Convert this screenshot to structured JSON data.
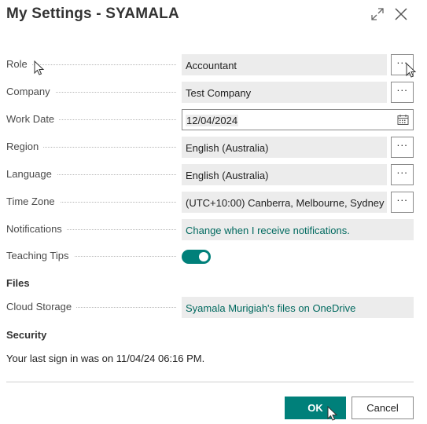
{
  "dialog": {
    "title": "My Settings - SYAMALA"
  },
  "fields": {
    "role": {
      "label": "Role",
      "value": "Accountant",
      "button": "···"
    },
    "company": {
      "label": "Company",
      "value": "Test Company",
      "button": "···"
    },
    "work_date": {
      "label": "Work Date",
      "value": "12/04/2024"
    },
    "region": {
      "label": "Region",
      "value": "English (Australia)",
      "button": "···"
    },
    "language": {
      "label": "Language",
      "value": "English (Australia)",
      "button": "···"
    },
    "time_zone": {
      "label": "Time Zone",
      "value": "(UTC+10:00) Canberra, Melbourne, Sydney",
      "button": "···"
    },
    "notifications": {
      "label": "Notifications",
      "value": "Change when I receive notifications."
    },
    "teaching_tips": {
      "label": "Teaching Tips",
      "on": true
    }
  },
  "files": {
    "heading": "Files",
    "cloud_storage": {
      "label": "Cloud Storage",
      "value": "Syamala Murigiah's files on OneDrive"
    }
  },
  "security": {
    "heading": "Security",
    "last_sign_in": "Your last sign in was on 11/04/24 06:16 PM."
  },
  "footer": {
    "ok_label": "OK",
    "cancel_label": "Cancel"
  },
  "colors": {
    "accent": "#00807a",
    "link": "#00695f",
    "field_bg": "#ececec"
  },
  "icons": {
    "expand": "expand-icon",
    "close": "close-icon",
    "calendar": "calendar-icon"
  }
}
